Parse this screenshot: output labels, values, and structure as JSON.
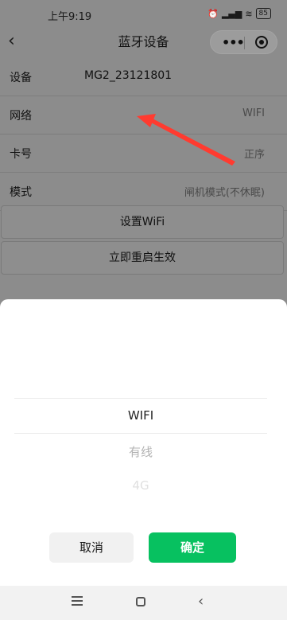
{
  "status_bar": {
    "time": "上午9:19",
    "battery": "85"
  },
  "nav": {
    "title": "蓝牙设备"
  },
  "rows": [
    {
      "label": "设备",
      "value": "MG2_23121801",
      "align": "left"
    },
    {
      "label": "网络",
      "value": "WIFI",
      "align": "right"
    },
    {
      "label": "卡号",
      "value": "正序",
      "align": "right"
    },
    {
      "label": "模式",
      "value": "闸机模式(不休眠)",
      "align": "right"
    }
  ],
  "buttons": {
    "set_wifi": "设置WiFi",
    "restart": "立即重启生效"
  },
  "picker": {
    "options": [
      "WIFI",
      "有线",
      "4G"
    ],
    "selected": "WIFI"
  },
  "sheet_actions": {
    "cancel": "取消",
    "confirm": "确定"
  },
  "annotation": {
    "arrow_color": "#ff3b30"
  },
  "colors": {
    "confirm": "#07c160",
    "overlay": "#8c8c8c"
  }
}
